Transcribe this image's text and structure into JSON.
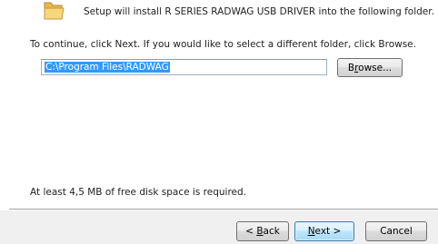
{
  "header": {
    "text": "Setup will install R SERIES RADWAG USB DRIVER into the following folder.",
    "icon": "folder-icon"
  },
  "instruction": "To continue, click Next. If you would like to select a different folder, click Browse.",
  "destination": {
    "value": "C:\\Program Files\\RADWAG"
  },
  "browse_button": {
    "pre": "B",
    "accel": "r",
    "post": "owse..."
  },
  "disk_space": "At least 4,5 MB of free disk space is required.",
  "buttons": {
    "back": {
      "pre": "< ",
      "accel": "B",
      "post": "ack"
    },
    "next": {
      "accel": "N",
      "post": "ext >"
    },
    "cancel": "Cancel"
  }
}
